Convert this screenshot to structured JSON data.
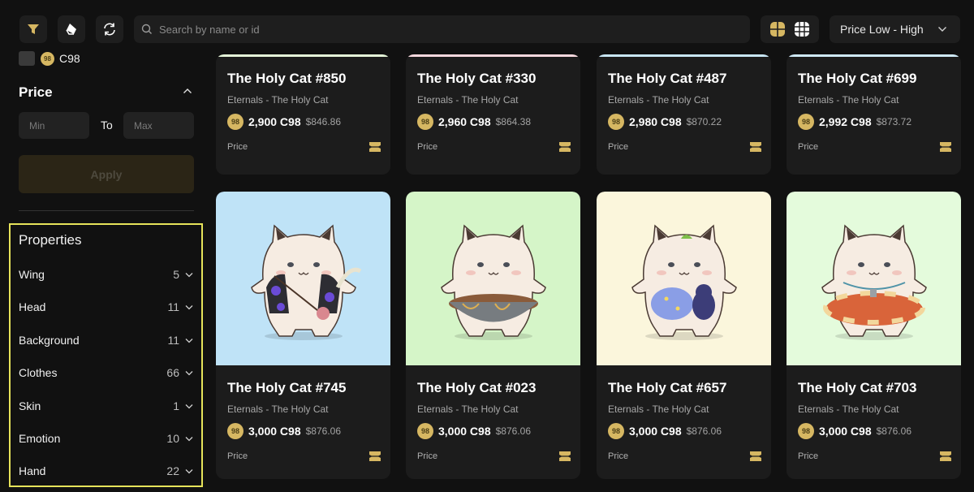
{
  "toolbar": {
    "icons": [
      "filter-icon",
      "clear-filter-icon",
      "refresh-icon"
    ],
    "search_placeholder": "Search by name or id",
    "search_value": "",
    "view_modes": [
      "large-grid",
      "small-grid"
    ],
    "active_view": "large-grid",
    "sort_label": "Price Low - High"
  },
  "sidebar": {
    "currency_filter": {
      "label": "C98",
      "checked": false
    },
    "price": {
      "title": "Price",
      "min_placeholder": "Min",
      "max_placeholder": "Max",
      "to_label": "To",
      "apply_label": "Apply"
    },
    "properties": {
      "title": "Properties",
      "items": [
        {
          "name": "Wing",
          "count": "5"
        },
        {
          "name": "Head",
          "count": "11"
        },
        {
          "name": "Background",
          "count": "11"
        },
        {
          "name": "Clothes",
          "count": "66"
        },
        {
          "name": "Skin",
          "count": "1"
        },
        {
          "name": "Emotion",
          "count": "10"
        },
        {
          "name": "Hand",
          "count": "22"
        }
      ]
    }
  },
  "colors": {
    "accent_gold": "#d6b762",
    "highlight_border": "#e6e35a",
    "background": "#111111",
    "card": "#1c1c1c"
  },
  "cards": [
    {
      "title": "The Holy Cat #850",
      "collection": "Eternals - The Holy Cat",
      "amount": "2,900 C98",
      "usd": "$846.86",
      "price_label": "Price",
      "coin_symbol": "98",
      "bg": "#e4f5d8"
    },
    {
      "title": "The Holy Cat #330",
      "collection": "Eternals - The Holy Cat",
      "amount": "2,960 C98",
      "usd": "$864.38",
      "price_label": "Price",
      "coin_symbol": "98",
      "bg": "#f7d8de"
    },
    {
      "title": "The Holy Cat #487",
      "collection": "Eternals - The Holy Cat",
      "amount": "2,980 C98",
      "usd": "$870.22",
      "price_label": "Price",
      "coin_symbol": "98",
      "bg": "#c8e6f5"
    },
    {
      "title": "The Holy Cat #699",
      "collection": "Eternals - The Holy Cat",
      "amount": "2,992 C98",
      "usd": "$873.72",
      "price_label": "Price",
      "coin_symbol": "98",
      "bg": "#cfe9f7"
    },
    {
      "title": "The Holy Cat #745",
      "collection": "Eternals - The Holy Cat",
      "amount": "3,000 C98",
      "usd": "$876.06",
      "price_label": "Price",
      "coin_symbol": "98",
      "bg": "#bfe3f7",
      "art": "hawaiian-shirt"
    },
    {
      "title": "The Holy Cat #023",
      "collection": "Eternals - The Holy Cat",
      "amount": "3,000 C98",
      "usd": "$876.06",
      "price_label": "Price",
      "coin_symbol": "98",
      "bg": "#d5f5c8",
      "art": "noodle-pot"
    },
    {
      "title": "The Holy Cat #657",
      "collection": "Eternals - The Holy Cat",
      "amount": "3,000 C98",
      "usd": "$876.06",
      "price_label": "Price",
      "coin_symbol": "98",
      "bg": "#fbf6dc",
      "art": "pillow-plush"
    },
    {
      "title": "The Holy Cat #703",
      "collection": "Eternals - The Holy Cat",
      "amount": "3,000 C98",
      "usd": "$876.06",
      "price_label": "Price",
      "coin_symbol": "98",
      "bg": "#e4fbdc",
      "art": "swim-ring"
    }
  ]
}
